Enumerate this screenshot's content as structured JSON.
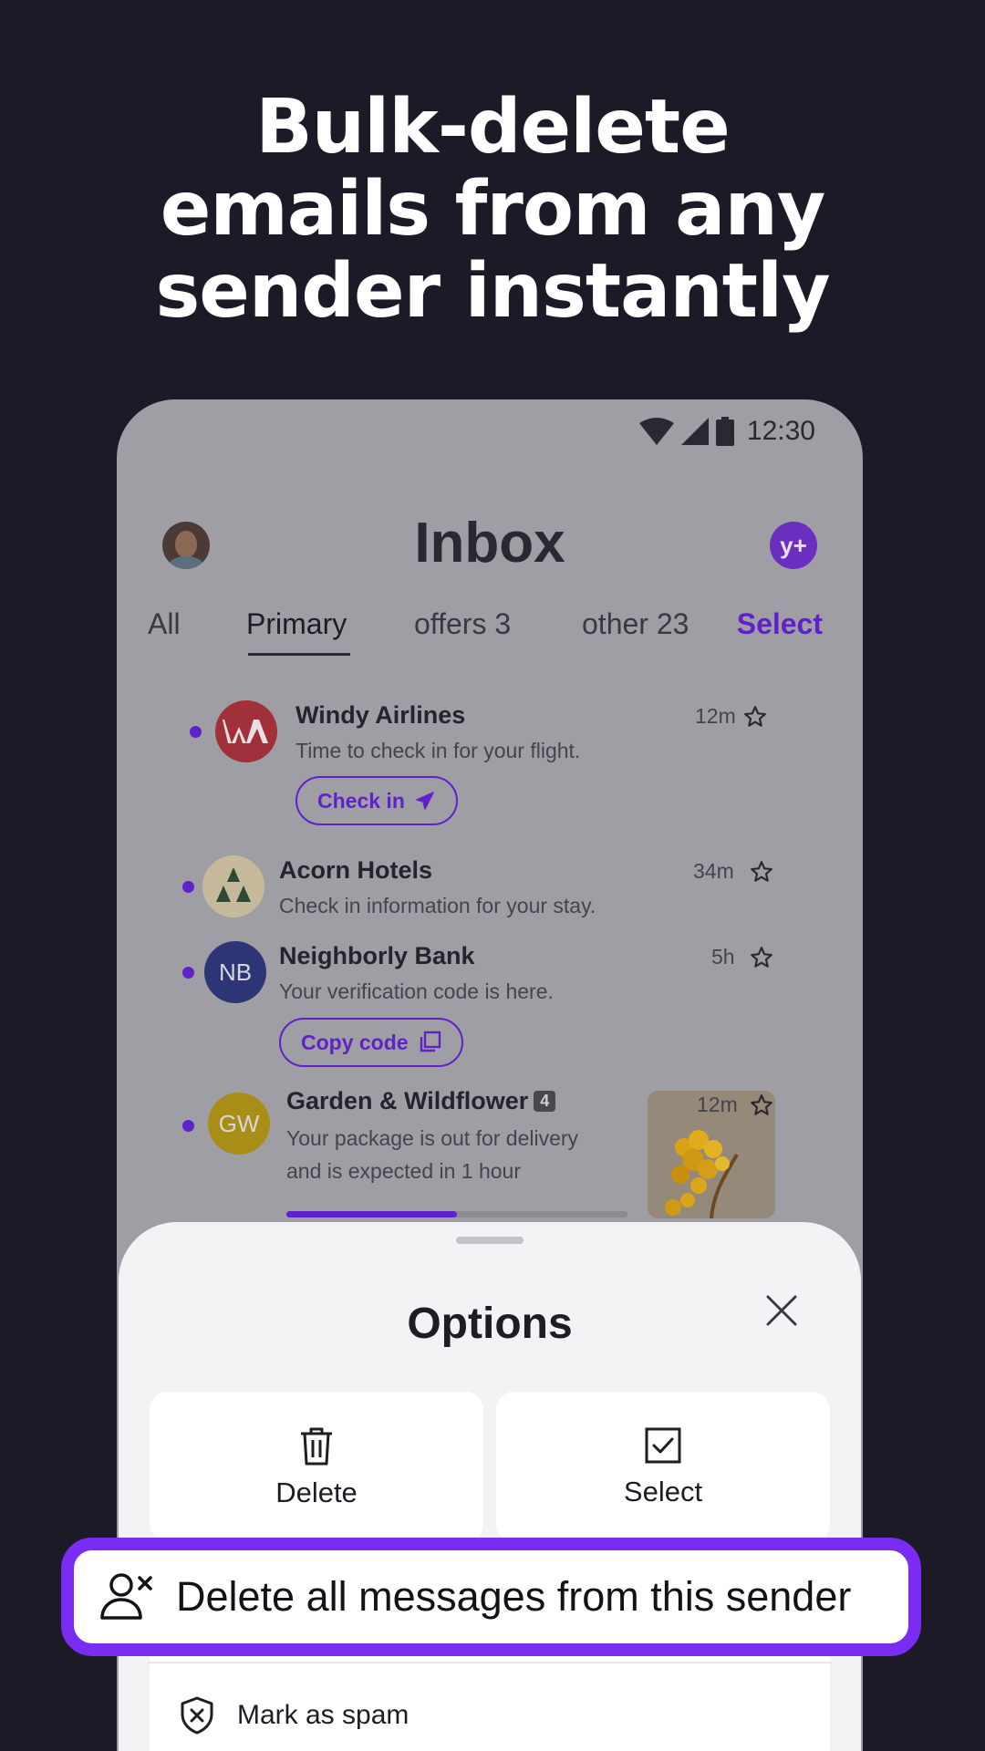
{
  "headline": {
    "line1": "Bulk-delete",
    "line2": "emails from any",
    "line3": "sender instantly"
  },
  "status_bar": {
    "time": "12:30",
    "icons": [
      "wifi-icon",
      "signal-icon",
      "battery-icon"
    ]
  },
  "header": {
    "title": "Inbox",
    "badge": "y+"
  },
  "tabs": [
    {
      "label": "All"
    },
    {
      "label": "Primary",
      "active": true
    },
    {
      "label": "offers 3"
    },
    {
      "label": "other 23"
    }
  ],
  "select_link": "Select",
  "emails": [
    {
      "sender": "Windy Airlines",
      "snippet": "Time to check in for your flight.",
      "time": "12m",
      "avatar": "WA",
      "action": "Check in",
      "action_icon": "airplane-icon",
      "unread": true
    },
    {
      "sender": "Acorn Hotels",
      "snippet": "Check in information for your stay.",
      "time": "34m",
      "avatar": "",
      "unread": true
    },
    {
      "sender": "Neighborly Bank",
      "snippet": "Your verification code is here.",
      "time": "5h",
      "avatar": "NB",
      "action": "Copy code",
      "action_icon": "copy-icon",
      "unread": true
    },
    {
      "sender": "Garden & Wildflower",
      "count": "4",
      "snippet_line1": "Your package is out for delivery",
      "snippet_line2": "and is expected in 1 hour",
      "time": "12m",
      "avatar": "GW",
      "progress": 0.5,
      "unread": true
    }
  ],
  "options_sheet": {
    "title": "Options",
    "delete_label": "Delete",
    "select_label": "Select",
    "delete_all_label": "Delete all messages from this sender",
    "spam_label": "Mark as spam"
  },
  "colors": {
    "background": "#1c1a26",
    "accent": "#5f22c8",
    "highlight": "#7a2cf2"
  }
}
